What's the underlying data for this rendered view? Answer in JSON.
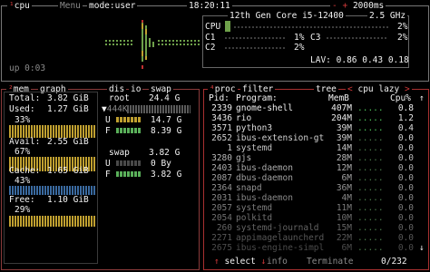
{
  "topbar": {
    "cpu_tab": "cpu",
    "menu_tab": "Menu",
    "mode_tab": "mode:user",
    "clock": "18:20:11",
    "refresh_minus": "-",
    "refresh_plus": "+",
    "refresh": "2000ms"
  },
  "cpu": {
    "model": "12th Gen Core i5-12400",
    "freq": "2.5 GHz",
    "total_label": "CPU",
    "total_pct": "2%",
    "cores": [
      {
        "label": "C1",
        "pct": "1%"
      },
      {
        "label": "C2",
        "pct": "2%"
      },
      {
        "label": "C3",
        "pct": "2%"
      }
    ],
    "lav_label": "LAV:",
    "lav": "0.86 0.43 0.18",
    "uptime": "up 0:03"
  },
  "mem": {
    "title_mem": "mem",
    "title_graph": "graph",
    "total_label": "Total:",
    "total_val": "3.82 GiB",
    "used_label": "Used:",
    "used_val": "1.27 GiB",
    "used_pct": "33%",
    "used_fraction": 0.33,
    "avail_label": "Avail:",
    "avail_val": "2.55 GiB",
    "avail_pct": "67%",
    "avail_fraction": 0.67,
    "cache_label": "Cache:",
    "cache_val": "1.65 GiB",
    "cache_pct": "43%",
    "cache_fraction": 0.43,
    "free_label": "Free:",
    "free_val": "1.10 GiB",
    "free_pct": "29%",
    "free_fraction": 0.29
  },
  "disks": {
    "tab_dis": "dis",
    "tab_io": "io",
    "tab_swap": "swap",
    "root_label": "root",
    "root_size": "24.4 G",
    "root_sub": "444K",
    "root_u_label": "U",
    "root_u_val": "14.7 G",
    "root_f_label": "F",
    "root_f_val": "8.39 G",
    "swap_label": "swap",
    "swap_size": "3.82 G",
    "swap_u_label": "U",
    "swap_u_val": "0 By",
    "swap_f_label": "F",
    "swap_f_val": "3.82 G"
  },
  "proc": {
    "tab_proc": "proc",
    "tab_filter": "filter",
    "tab_tree": "tree",
    "sort_left": "<",
    "sort_value": "cpu lazy",
    "sort_right": ">",
    "col_pid": "Pid:",
    "col_program": "Program:",
    "col_memb": "MemB",
    "col_cpu": "Cpu%",
    "rows": [
      {
        "pid": "2339",
        "name": "gnome-shell",
        "mem": "407M",
        "cpu": "0.8"
      },
      {
        "pid": "3436",
        "name": "rio",
        "mem": "204M",
        "cpu": "1.2"
      },
      {
        "pid": "3571",
        "name": "python3",
        "mem": "39M",
        "cpu": "0.4"
      },
      {
        "pid": "2652",
        "name": "ibus-extension-gt",
        "mem": "39M",
        "cpu": "0.0"
      },
      {
        "pid": "1",
        "name": "systemd",
        "mem": "14M",
        "cpu": "0.0"
      },
      {
        "pid": "3280",
        "name": "gjs",
        "mem": "28M",
        "cpu": "0.0"
      },
      {
        "pid": "2403",
        "name": "ibus-daemon",
        "mem": "12M",
        "cpu": "0.0"
      },
      {
        "pid": "2087",
        "name": "dbus-daemon",
        "mem": "6M",
        "cpu": "0.0"
      },
      {
        "pid": "2364",
        "name": "snapd",
        "mem": "36M",
        "cpu": "0.0"
      },
      {
        "pid": "2031",
        "name": "ibus-daemon",
        "mem": "4M",
        "cpu": "0.0"
      },
      {
        "pid": "2057",
        "name": "systemd",
        "mem": "11M",
        "cpu": "0.0"
      },
      {
        "pid": "2054",
        "name": "polkitd",
        "mem": "10M",
        "cpu": "0.0"
      },
      {
        "pid": "260",
        "name": "systemd-journald",
        "mem": "15M",
        "cpu": "0.0"
      },
      {
        "pid": "2271",
        "name": "appimagelauncherd",
        "mem": "22M",
        "cpu": "0.0"
      },
      {
        "pid": "2675",
        "name": "ibus-engine-simpl",
        "mem": "6M",
        "cpu": "0.0"
      }
    ],
    "footer_up": "↑",
    "footer_select": "select",
    "footer_down": "↓",
    "footer_info": "info",
    "footer_terminate": "Terminate",
    "footer_count": "0/232"
  },
  "colors": {
    "cpu_border": "#7a7a7a",
    "mem_border": "#8a3a3a",
    "proc_border": "#a83030",
    "graph_green": "#6ea04a",
    "title_red": "#d43a3a"
  }
}
